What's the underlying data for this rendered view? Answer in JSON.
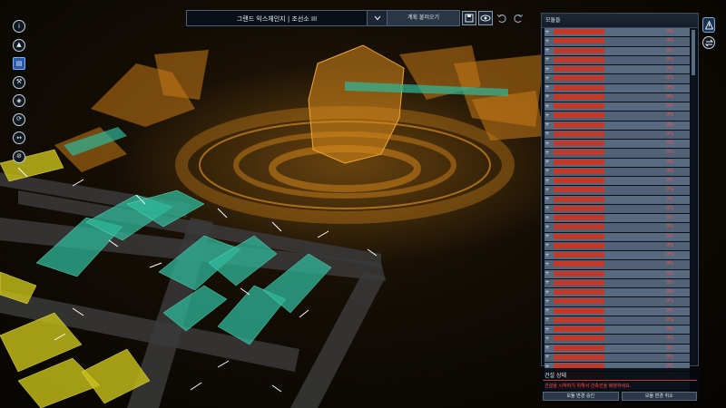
{
  "topbar": {
    "title": "그랜드 익스체인지 | 조선소 III",
    "load_label": "계획 불러오기"
  },
  "left_toolbar": [
    {
      "icon": "info-icon"
    },
    {
      "icon": "navigate-icon"
    },
    {
      "icon": "blueprint-icon",
      "active": true
    },
    {
      "icon": "build-icon"
    },
    {
      "icon": "cargo-icon"
    },
    {
      "icon": "sync-icon"
    },
    {
      "icon": "connect-icon"
    },
    {
      "icon": "no-entry-icon"
    }
  ],
  "module_panel": {
    "title": "모듈들",
    "rows": [
      {
        "name": "",
        "pct": "0%"
      },
      {
        "name": "",
        "pct": "0%"
      },
      {
        "name": "",
        "pct": "0%"
      },
      {
        "name": "",
        "pct": "0%"
      },
      {
        "name": "",
        "pct": "0%"
      },
      {
        "name": "",
        "pct": "0%"
      },
      {
        "name": "",
        "pct": "0%"
      },
      {
        "name": "",
        "pct": "0%"
      },
      {
        "name": "",
        "pct": "0%"
      },
      {
        "name": "",
        "pct": "0%"
      },
      {
        "name": "",
        "pct": "0%"
      },
      {
        "name": "",
        "pct": "0%"
      },
      {
        "name": "",
        "pct": "0%"
      },
      {
        "name": "",
        "pct": "0%"
      },
      {
        "name": "",
        "pct": "0%"
      },
      {
        "name": "",
        "pct": "0%"
      },
      {
        "name": "",
        "pct": "0%"
      },
      {
        "name": "",
        "pct": "0%"
      },
      {
        "name": "",
        "pct": "0%"
      },
      {
        "name": "",
        "pct": "0%"
      },
      {
        "name": "",
        "pct": "0%"
      },
      {
        "name": "",
        "pct": "0%"
      },
      {
        "name": "",
        "pct": "0%"
      },
      {
        "name": "",
        "pct": "0%"
      },
      {
        "name": "",
        "pct": "0%"
      },
      {
        "name": "",
        "pct": "0%"
      },
      {
        "name": "",
        "pct": "0%"
      },
      {
        "name": "",
        "pct": "0%"
      },
      {
        "name": "",
        "pct": "0%"
      },
      {
        "name": "",
        "pct": "0%"
      },
      {
        "name": "",
        "pct": "0%"
      },
      {
        "name": "",
        "pct": "0%"
      },
      {
        "name": "",
        "pct": "0%"
      },
      {
        "name": "",
        "pct": "0%"
      },
      {
        "name": "",
        "pct": "0%"
      },
      {
        "name": "",
        "pct": "0%"
      },
      {
        "name": "",
        "pct": "0%"
      },
      {
        "name": "",
        "pct": "0%"
      },
      {
        "name": "",
        "pct": "0%"
      },
      {
        "name": "",
        "pct": "0%"
      }
    ]
  },
  "right_icons": {
    "top": "alert-icon",
    "bottom": "swap-icon"
  },
  "build_status": {
    "title": "건설 상태",
    "message": "건설을 시작하기 위해서 건축선을 배정하세요.",
    "confirm_label": "모듈 변경 승인",
    "cancel_label": "모듈 변경 취소"
  },
  "colors": {
    "accent_red": "#c0392b",
    "hologram_orange": "#d98a1c",
    "module_teal": "#2fb89a",
    "module_yellow": "#c9c21a",
    "panel_blue": "#586a80"
  }
}
